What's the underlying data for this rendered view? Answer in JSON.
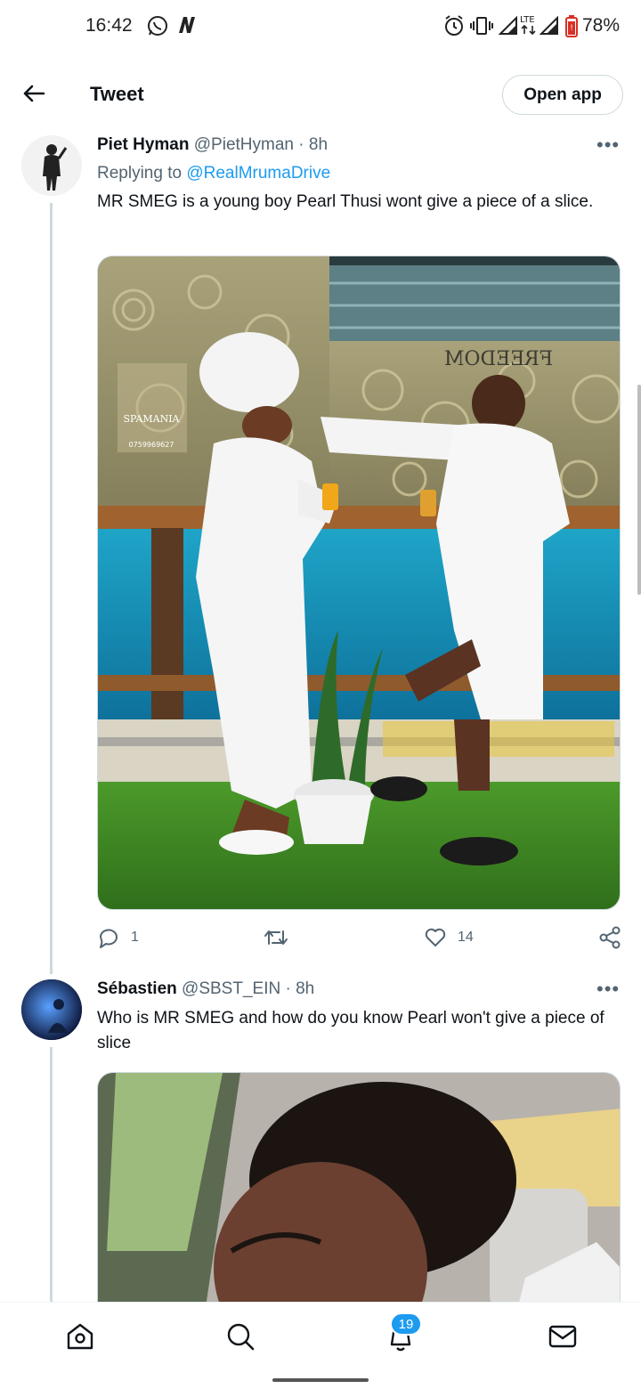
{
  "status_bar": {
    "time": "16:42",
    "battery": "78%",
    "icons": [
      "whatsapp-icon",
      "n-app-icon",
      "alarm-icon",
      "vibrate-icon",
      "signal-icon",
      "lte-icon",
      "signal-icon",
      "battery-icon"
    ]
  },
  "header": {
    "title": "Tweet",
    "open_app_label": "Open app",
    "back_icon": "arrow-left-icon"
  },
  "tweets": [
    {
      "name": "Piet Hyman",
      "handle": "@PietHyman",
      "separator": "·",
      "time": "8h",
      "replying_to_label": "Replying to",
      "replying_to_handle": "@RealMrumaDrive",
      "text": "MR SMEG is a young boy Pearl Thusi wont give a piece of a slice.",
      "media_text": {
        "logo": "SPAMANIA",
        "phone": "0759969627",
        "sign": "FREEDOM"
      },
      "actions": {
        "replies": "1",
        "retweets": "",
        "likes": "14"
      }
    },
    {
      "name": "Sébastien",
      "handle": "@SBST_EIN",
      "separator": "·",
      "time": "8h",
      "text": "Who is MR SMEG and how do you know Pearl won't give a piece of slice"
    }
  ],
  "bottom_nav": {
    "items": [
      "home-icon",
      "search-icon",
      "notifications-icon",
      "messages-icon"
    ],
    "notifications_badge": "19"
  },
  "colors": {
    "accent": "#1d9bf0",
    "text_primary": "#0f1419",
    "text_secondary": "#536471",
    "border": "#cfd9de"
  }
}
